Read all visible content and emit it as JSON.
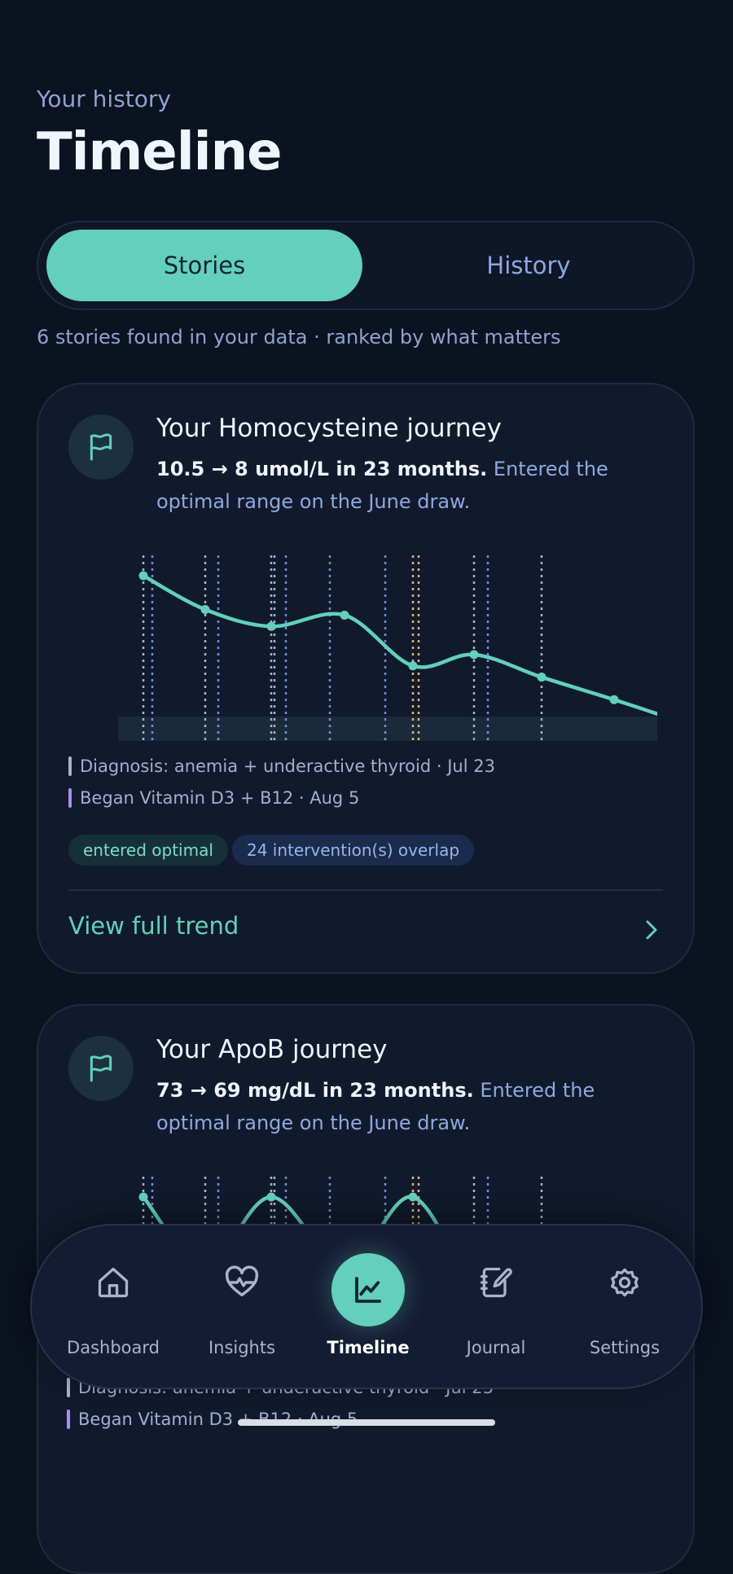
{
  "header": {
    "eyebrow": "Your history",
    "title": "Timeline"
  },
  "segment": {
    "tabs": [
      {
        "label": "Stories",
        "active": true
      },
      {
        "label": "History",
        "active": false
      }
    ]
  },
  "summary": "6 stories found in your data · ranked by what matters",
  "cards": [
    {
      "title": "Your Homocysteine journey",
      "highlight": "10.5 → 8 umol/L in 23 months.",
      "description": " Entered the optimal range on the June draw.",
      "legend": [
        {
          "label": "Diagnosis: anemia + underactive thyroid · Jul 23",
          "color": "#a9b3c6"
        },
        {
          "label": "Began Vitamin D3 + B12 · Aug 5",
          "color": "#a98df0"
        }
      ],
      "badges": [
        "entered optimal",
        "24 intervention(s) overlap"
      ],
      "cta": "View full trend"
    },
    {
      "title": "Your ApoB journey",
      "highlight": "73 → 69 mg/dL in 23 months.",
      "description": " Entered the optimal range on the June draw.",
      "legend": [
        {
          "label": "Diagnosis: anemia + underactive thyroid · Jul 23",
          "color": "#a9b3c6"
        },
        {
          "label": "Began Vitamin D3 + B12 · Aug 5",
          "color": "#a98df0"
        }
      ]
    }
  ],
  "chart_data": [
    {
      "type": "line",
      "series": [
        {
          "values": [
            10.5,
            9.9,
            9.6,
            9.8,
            8.9,
            9.1,
            8.7,
            8.3,
            8.0
          ]
        }
      ],
      "colors": {
        "line": "#62d0bd",
        "optimal_band": "#1a2a3a",
        "marker_gray": "#a9b3c6",
        "marker_blue": "#6c8fd8",
        "marker_orange": "#e8b062"
      }
    },
    {
      "type": "line",
      "series": [
        {
          "values": [
            73,
            71,
            73,
            71,
            73,
            70
          ]
        }
      ]
    }
  ],
  "nav": {
    "items": [
      {
        "label": "Dashboard",
        "icon": "home-icon"
      },
      {
        "label": "Insights",
        "icon": "heart-pulse-icon"
      },
      {
        "label": "Timeline",
        "icon": "chart-line-icon",
        "active": true
      },
      {
        "label": "Journal",
        "icon": "journal-pen-icon"
      },
      {
        "label": "Settings",
        "icon": "gear-icon"
      }
    ]
  }
}
